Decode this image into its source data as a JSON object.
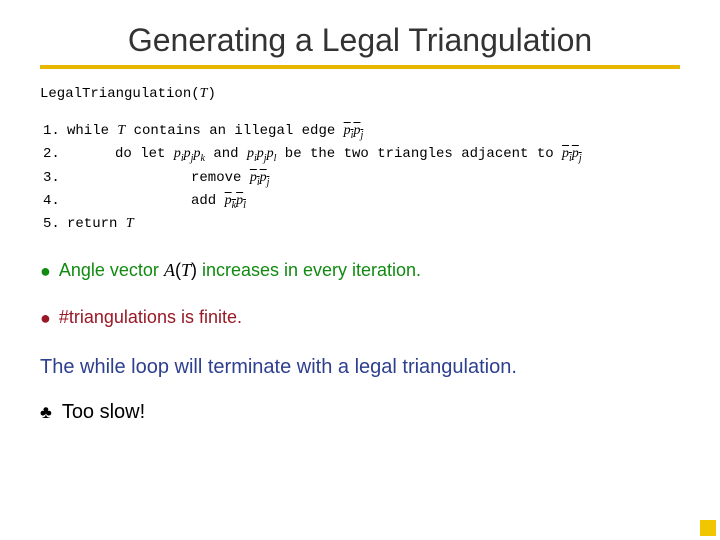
{
  "title": "Generating a Legal Triangulation",
  "algo": {
    "head": {
      "name": "LegalTriangulation",
      "arg": "T"
    },
    "lines": {
      "l1": {
        "num": "1.",
        "kw": "while",
        "text_before": "",
        "T": "T",
        "contains": " contains an illegal edge ",
        "edge": "pᵢpⱼ"
      },
      "l2": {
        "num": "2.",
        "kw": "do let",
        "tri1": "pᵢpⱼpₖ",
        "and": " and ",
        "tri2": "pᵢpⱼpₗ",
        "tail": " be the two triangles adjacent to ",
        "edge": "pᵢpⱼ"
      },
      "l3": {
        "num": "3.",
        "kw": "remove",
        "edge": "pᵢpⱼ"
      },
      "l4": {
        "num": "4.",
        "kw": "add",
        "edge": "pₖpₗ"
      },
      "l5": {
        "num": "5.",
        "kw": "return",
        "T": "T"
      }
    }
  },
  "bullets": {
    "angle": {
      "pre": "Angle vector ",
      "A": "A",
      "T": "T",
      "post": " increases in every iteration."
    },
    "finite": "#triangulations is finite."
  },
  "statement": "The while loop will terminate with a legal triangulation.",
  "too_slow": "Too slow!",
  "symbols": {
    "bullet": "●",
    "club": "♣"
  }
}
